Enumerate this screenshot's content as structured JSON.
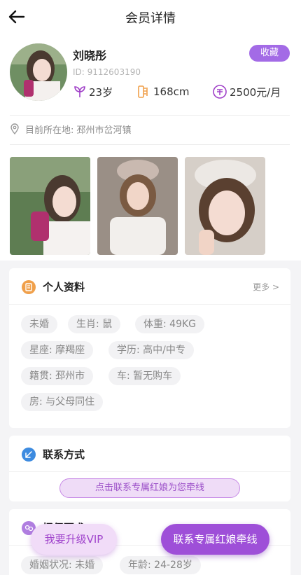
{
  "header": {
    "title": "会员详情"
  },
  "profile": {
    "name": "刘晓彤",
    "id_text": "ID: 9112603190",
    "favorite_label": "收藏",
    "age": "23岁",
    "height": "168cm",
    "income": "2500元/月",
    "location": "目前所在地: 邳州市岔河镇"
  },
  "info_card": {
    "title": "个人资料",
    "more": "更多 >",
    "tags": [
      "未婚",
      "生肖: 鼠",
      "体重: 49KG",
      "星座: 摩羯座",
      "学历: 高中/中专",
      "籍贯: 邳州市",
      "车: 暂无购车",
      "房: 与父母同住"
    ]
  },
  "contact_card": {
    "title": "联系方式",
    "button_label": "点击联系专属红娘为您牵线"
  },
  "requirements_card": {
    "title": "择偶要求",
    "tags": [
      "婚姻状况: 未婚",
      "年龄: 24-28岁"
    ]
  },
  "actions": {
    "vip_label": "我要升级VIP",
    "match_label": "联系专属红娘牵线"
  },
  "colors": {
    "accent": "#9e4fd8",
    "favorite": "#a36be6",
    "info_icon": "#f0a04b",
    "contact_icon": "#3d8be0",
    "req_icon": "#b07ee0"
  }
}
